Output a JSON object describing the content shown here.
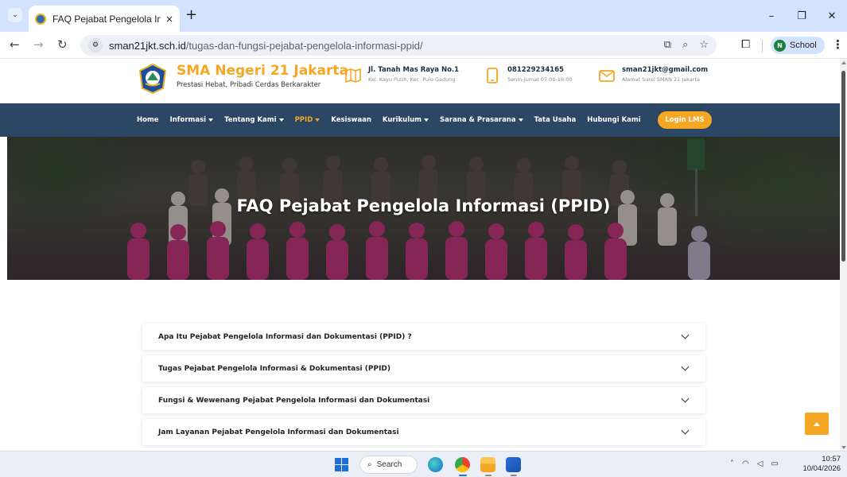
{
  "browser": {
    "tab_title": "FAQ Pejabat Pengelola Informasi",
    "tab_close": "×",
    "new_tab": "+",
    "url_host": "sman21jkt.sch.id",
    "url_path": "/tugas-dan-fungsi-pejabat-pengelola-informasi-ppid/",
    "profile_initial": "N",
    "profile_label": "School",
    "window_controls": [
      "–",
      "❐",
      "✕"
    ]
  },
  "site": {
    "name": "SMA Negeri 21 Jakarta",
    "tagline": "Prestasi Hebat, Pribadi Cerdas Berkarakter",
    "info": [
      {
        "title": "Jl. Tanah Mas Raya No.1",
        "sub": "Kel. Kayu Putih, Kec. Pulo Gadung",
        "icon": "map-icon"
      },
      {
        "title": "081229234165",
        "sub": "Senin-Jumat 07:00-16:00",
        "icon": "phone-icon"
      },
      {
        "title": "sman21jkt@gmail.com",
        "sub": "Alamat Surel SMAN 21 Jakarta",
        "icon": "mail-icon"
      }
    ],
    "colors": {
      "accent": "#f5a623",
      "navbar": "#2b4763"
    }
  },
  "nav": {
    "items": [
      {
        "label": "Home",
        "dropdown": false,
        "active": false
      },
      {
        "label": "Informasi",
        "dropdown": true,
        "active": false
      },
      {
        "label": "Tentang Kami",
        "dropdown": true,
        "active": false
      },
      {
        "label": "PPID",
        "dropdown": true,
        "active": true
      },
      {
        "label": "Kesiswaan",
        "dropdown": false,
        "active": false
      },
      {
        "label": "Kurikulum",
        "dropdown": true,
        "active": false
      },
      {
        "label": "Sarana & Prasarana",
        "dropdown": true,
        "active": false
      },
      {
        "label": "Tata Usaha",
        "dropdown": false,
        "active": false
      },
      {
        "label": "Hubungi Kami",
        "dropdown": false,
        "active": false
      }
    ],
    "login_label": "Login LMS"
  },
  "hero": {
    "title": "FAQ Pejabat Pengelola Informasi (PPID)"
  },
  "faq": [
    "Apa Itu Pejabat Pengelola Informasi dan Dokumentasi (PPID) ?",
    "Tugas Pejabat Pengelola Informasi & Dokumentasi (PPID)",
    "Fungsi & Wewenang Pejabat Pengelola Informasi dan Dokumentasi",
    "Jam Layanan Pejabat Pengelola Informasi dan Dokumentasi"
  ],
  "taskbar": {
    "search_label": "Search",
    "time": "10:57",
    "date": "10/04/2026"
  }
}
